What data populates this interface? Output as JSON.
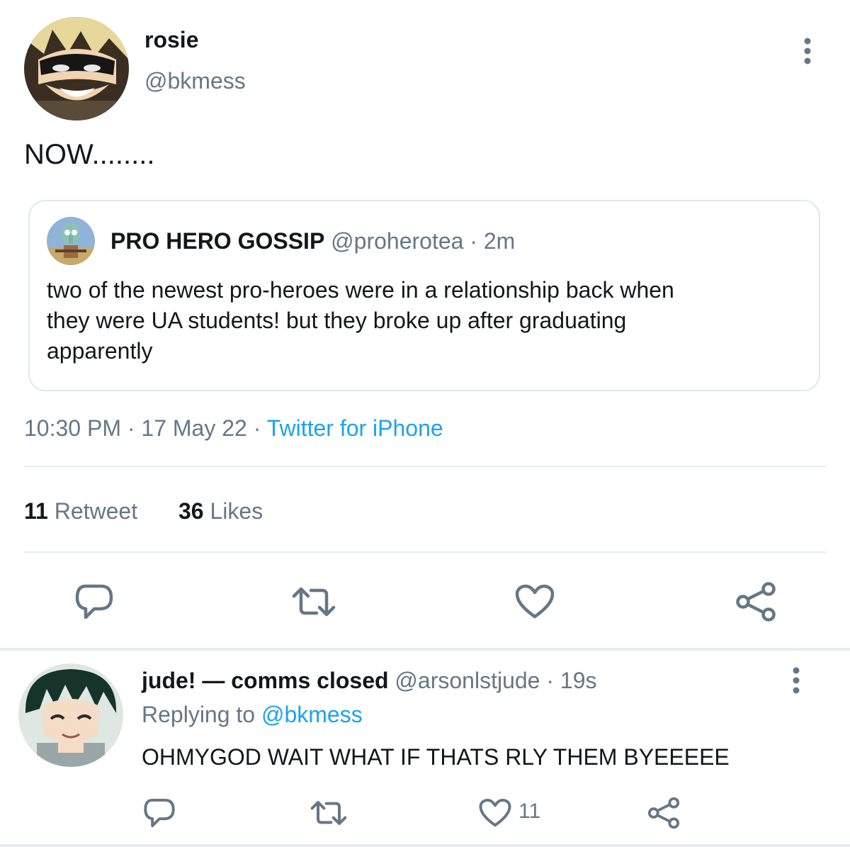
{
  "main_tweet": {
    "display_name": "rosie",
    "handle": "@bkmess",
    "text": "NOW........",
    "timestamp": "10:30 PM",
    "date": "17 May 22",
    "source": "Twitter for iPhone",
    "separator": "·",
    "retweet_count": "11",
    "retweet_label": "Retweet",
    "like_count": "36",
    "like_label": "Likes"
  },
  "quoted_tweet": {
    "display_name": "PRO HERO GOSSIP",
    "handle": "@proherotea",
    "time": "· 2m",
    "text_line1": "two of the newest pro-heroes were in a relationship back when",
    "text_line2": "they were UA students! but they broke up after graduating",
    "text_line3": "apparently"
  },
  "reply": {
    "display_name": "jude! — comms closed",
    "handle": "@arsonlstjude",
    "time": "· 19s",
    "replying_label": "Replying to",
    "replying_handle": "@bkmess",
    "text": "OHMYGOD WAIT WHAT IF THATS RLY THEM BYEEEEE",
    "like_count": "11"
  },
  "icons": {
    "more": "more-vertical-icon",
    "reply": "reply-bubble-icon",
    "retweet": "retweet-icon",
    "like": "heart-icon",
    "share": "share-icon"
  },
  "colors": {
    "text": "#14171a",
    "secondary": "#657786",
    "link": "#1da1f2",
    "divider": "#e6ecf0"
  }
}
